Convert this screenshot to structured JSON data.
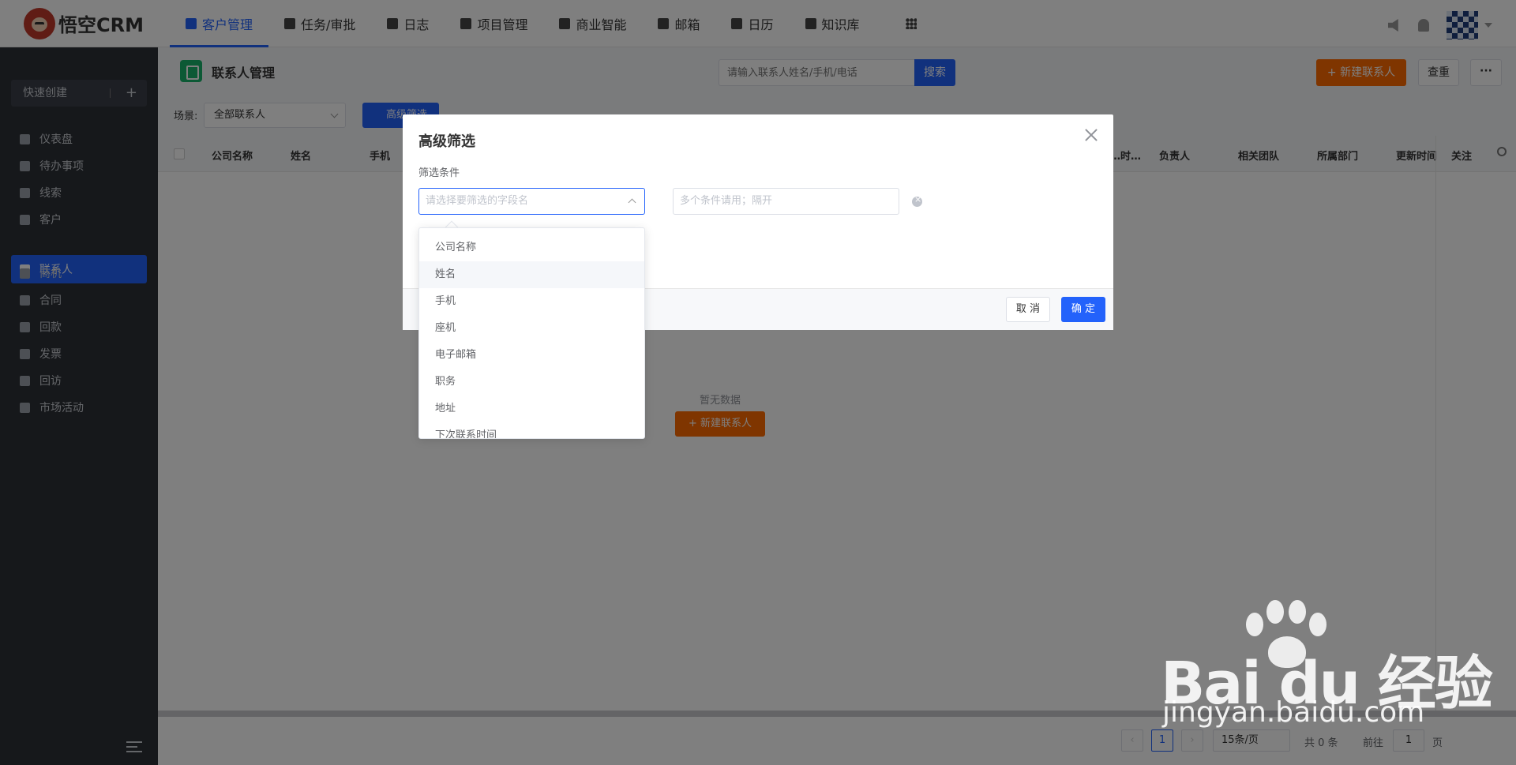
{
  "app": {
    "brand": "悟空CRM"
  },
  "topnav": {
    "items": [
      {
        "label": "客户管理",
        "icon": "customer-icon"
      },
      {
        "label": "任务/审批",
        "icon": "briefcase-icon"
      },
      {
        "label": "日志",
        "icon": "log-icon"
      },
      {
        "label": "项目管理",
        "icon": "project-icon"
      },
      {
        "label": "商业智能",
        "icon": "bi-icon"
      },
      {
        "label": "邮箱",
        "icon": "mail-icon"
      },
      {
        "label": "日历",
        "icon": "calendar-icon"
      },
      {
        "label": "知识库",
        "icon": "book-icon"
      }
    ],
    "active_index": 0
  },
  "sidebar": {
    "quick_create": "快速创建",
    "items": [
      {
        "label": "仪表盘",
        "icon": "dashboard-icon"
      },
      {
        "label": "待办事项",
        "icon": "todo-icon"
      },
      {
        "label": "线索",
        "icon": "lead-icon"
      },
      {
        "label": "客户",
        "icon": "customer-icon"
      },
      {
        "label": "联系人",
        "icon": "contact-icon"
      },
      {
        "label": "商机",
        "icon": "opportunity-icon"
      },
      {
        "label": "合同",
        "icon": "contract-icon"
      },
      {
        "label": "回款",
        "icon": "payment-icon"
      },
      {
        "label": "发票",
        "icon": "invoice-icon"
      },
      {
        "label": "回访",
        "icon": "visit-icon"
      },
      {
        "label": "市场活动",
        "icon": "campaign-icon"
      }
    ],
    "active_index": 4
  },
  "page": {
    "title": "联系人管理",
    "search_placeholder": "请输入联系人姓名/手机/电话",
    "search_button": "搜索",
    "new_button": "+ 新建联系人",
    "check_button": "查重",
    "more_button": "···"
  },
  "filters": {
    "scene_label": "场景:",
    "scene_value": "全部联系人",
    "advanced_button": "高级筛选"
  },
  "table": {
    "columns": [
      "公司名称",
      "姓名",
      "手机",
      "…时…",
      "负责人",
      "相关团队",
      "所属部门",
      "更新时间",
      "关注"
    ],
    "empty_text": "暂无数据",
    "empty_button": "+ 新建联系人"
  },
  "pagination": {
    "prev": "‹",
    "current_page": "1",
    "next": "›",
    "page_size": "15条/页",
    "total": "共 0 条",
    "goto_label": "前往",
    "goto_value": "1",
    "page_suffix": "页"
  },
  "dialog": {
    "title": "高级筛选",
    "condition_label": "筛选条件",
    "field_placeholder": "请选择要筛选的字段名",
    "value_placeholder": "多个条件请用；隔开",
    "cancel": "取 消",
    "confirm": "确 定"
  },
  "dropdown": {
    "options": [
      "公司名称",
      "姓名",
      "手机",
      "座机",
      "电子邮箱",
      "职务",
      "地址",
      "下次联系时间"
    ],
    "hover_index": 1
  },
  "watermark": {
    "brand": "Bai du 经验",
    "url": "jingyan.baidu.com"
  },
  "colors": {
    "primary": "#2362fb",
    "accent": "#ff6a00",
    "sidebar_bg": "#2d3037"
  }
}
